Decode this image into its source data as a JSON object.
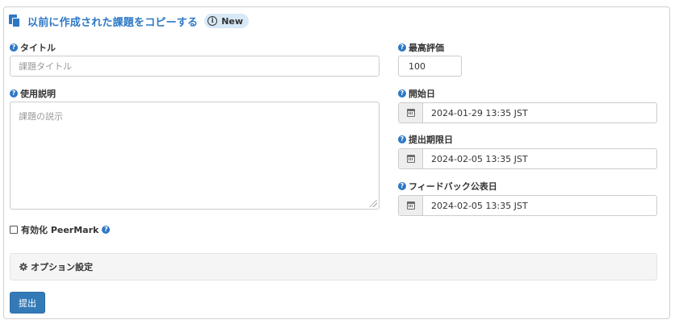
{
  "copy_assignment": {
    "label": "以前に作成された課題をコピーする",
    "badge_label": "New",
    "badge_icon": "info-circle-icon"
  },
  "title_field": {
    "label": "タイトル",
    "placeholder": "課題タイトル",
    "value": ""
  },
  "max_score_field": {
    "label": "最高評価",
    "value": "100"
  },
  "description_field": {
    "label": "使用説明",
    "placeholder": "課題の説示",
    "value": ""
  },
  "start_date_field": {
    "label": "開始日",
    "value": "2024-01-29 13:35 JST"
  },
  "due_date_field": {
    "label": "提出期限日",
    "value": "2024-02-05 13:35 JST"
  },
  "feedback_date_field": {
    "label": "フィードバック公表日",
    "value": "2024-02-05 13:35 JST"
  },
  "peermark": {
    "label": "有効化 PeerMark",
    "checked": false
  },
  "options": {
    "label": "オプション設定"
  },
  "submit": {
    "label": "提出"
  },
  "colors": {
    "accent": "#2d78c6",
    "primary_button": "#337ab7",
    "badge_background": "#d7e8f7"
  }
}
